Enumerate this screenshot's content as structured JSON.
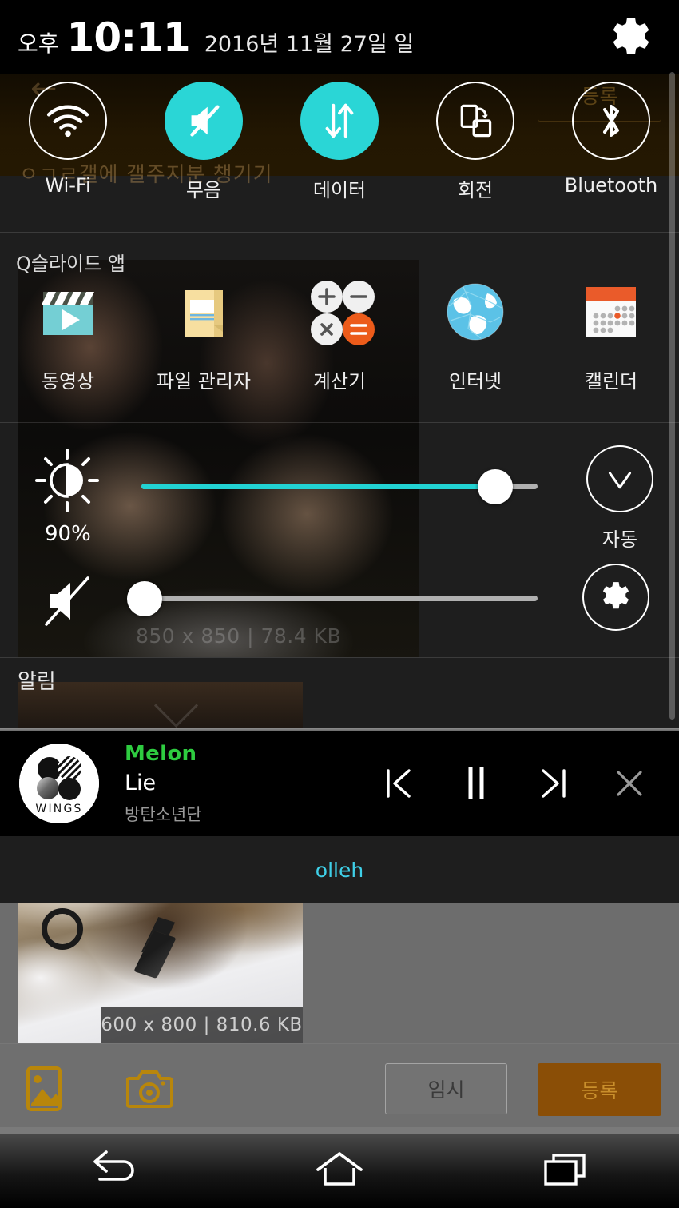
{
  "statusbar": {
    "ampm": "오후",
    "time": "10:11",
    "date": "2016년 11월 27일 일",
    "settings_icon": "gear-icon"
  },
  "quick_toggles": [
    {
      "label": "Wi-Fi",
      "icon": "wifi-icon",
      "active": false
    },
    {
      "label": "무음",
      "icon": "mute-icon",
      "active": true
    },
    {
      "label": "데이터",
      "icon": "data-sync-icon",
      "active": true
    },
    {
      "label": "회전",
      "icon": "rotation-icon",
      "active": false
    },
    {
      "label": "Bluetooth",
      "icon": "bluetooth-icon",
      "active": false
    }
  ],
  "qslide": {
    "title": "Q슬라이드 앱",
    "apps": [
      {
        "label": "동영상",
        "icon": "video-icon"
      },
      {
        "label": "파일 관리자",
        "icon": "file-manager-icon"
      },
      {
        "label": "계산기",
        "icon": "calculator-icon"
      },
      {
        "label": "인터넷",
        "icon": "internet-globe-icon"
      },
      {
        "label": "캘린더",
        "icon": "calendar-icon"
      }
    ],
    "photo_overlay": "850 x 850 | 78.4 KB"
  },
  "brightness": {
    "icon": "brightness-icon",
    "percent_label": "90%",
    "value": 90,
    "auto_label": "자동",
    "auto_icon": "checkmark-icon",
    "fill_color": "#22d3d3"
  },
  "volume": {
    "icon": "volume-muted-icon",
    "value": 0,
    "settings_icon": "gear-icon"
  },
  "notifications": {
    "title": "알림"
  },
  "music": {
    "app_name": "Melon",
    "app_color": "#2ecc40",
    "track_title": "Lie",
    "artist": "방탄소년단",
    "album_label": "WINGS",
    "controls": [
      {
        "name": "previous-track-button",
        "icon": "skip-previous-icon"
      },
      {
        "name": "pause-button",
        "icon": "pause-icon"
      },
      {
        "name": "next-track-button",
        "icon": "skip-next-icon"
      },
      {
        "name": "close-button",
        "icon": "close-icon"
      }
    ]
  },
  "carrier": {
    "name": "olleh",
    "color": "#3fd0e8"
  },
  "background_app": {
    "photo_overlay": "600 x 800 | 810.6 KB",
    "toolbar": {
      "gallery_icon": "gallery-icon",
      "camera_icon": "camera-icon",
      "temp_label": "임시",
      "submit_label": "등록",
      "submit_color": "#8a4e06"
    },
    "bleed_text": "ㅇㄱㄹ갤에 갤주지분 챙기기"
  },
  "navbar": [
    {
      "name": "back-button",
      "icon": "back-arrow-icon"
    },
    {
      "name": "home-button",
      "icon": "home-icon"
    },
    {
      "name": "recents-button",
      "icon": "recents-icon"
    }
  ]
}
